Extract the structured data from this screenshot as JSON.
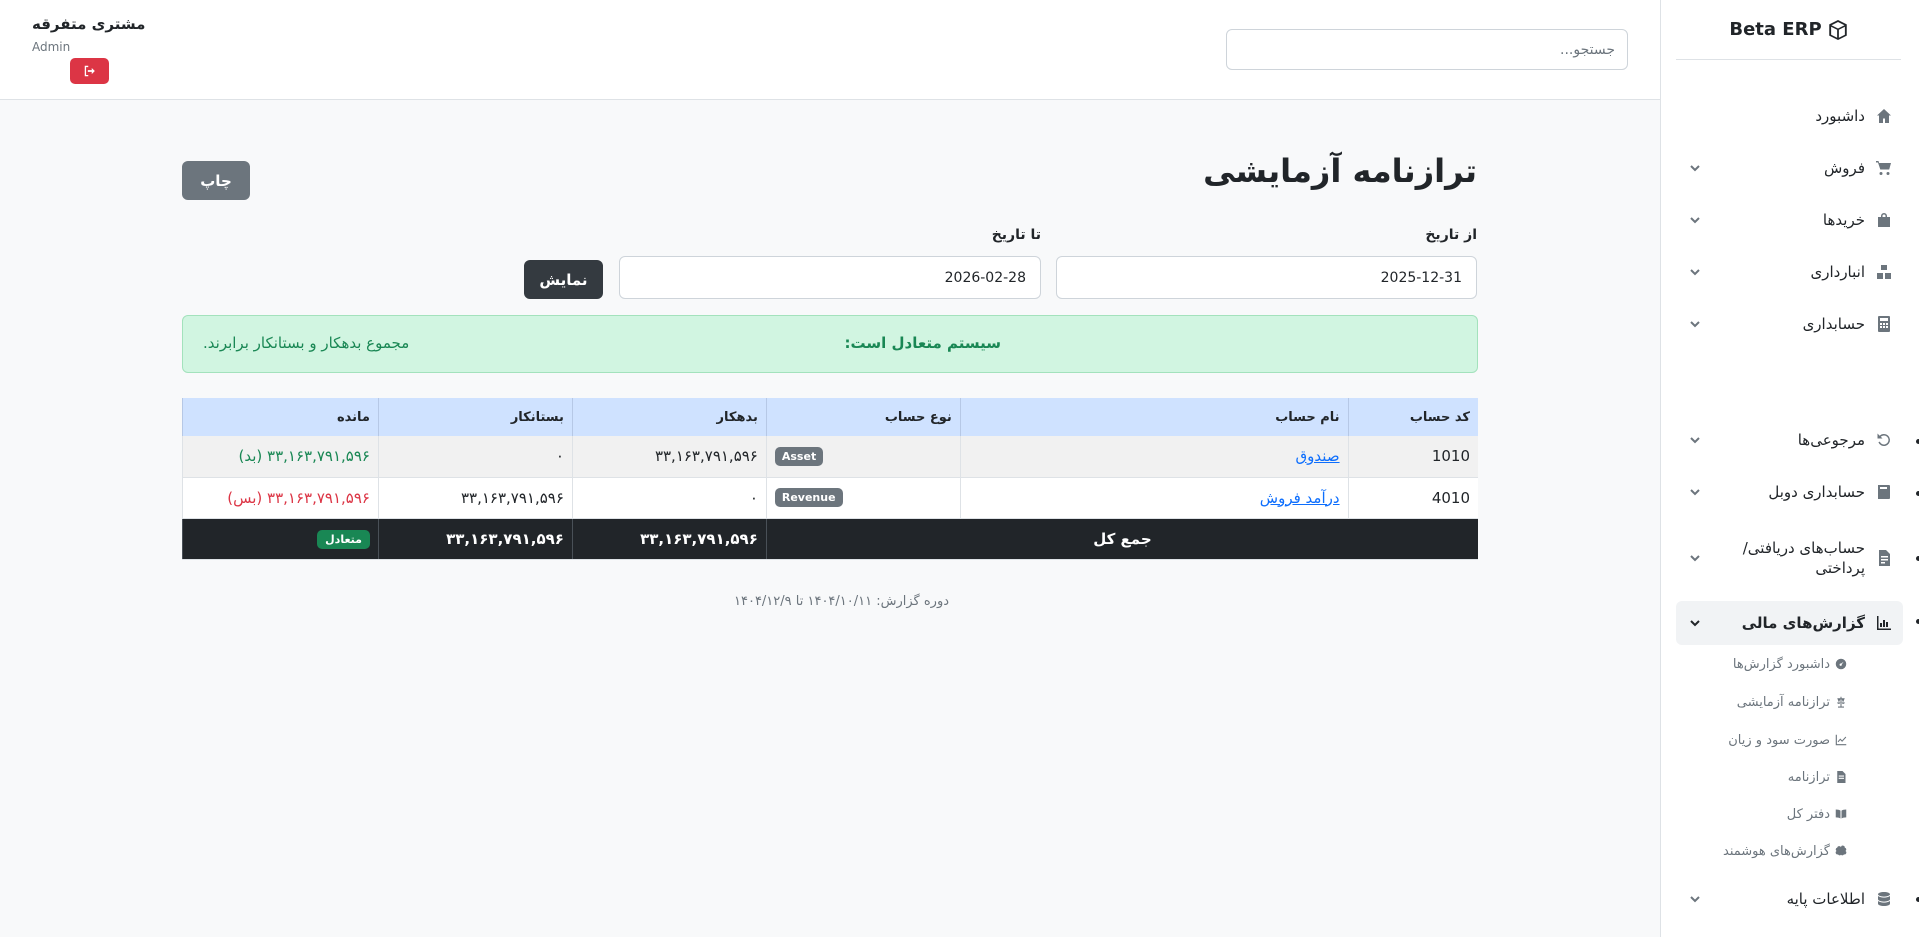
{
  "brand": {
    "name": "Beta ERP",
    "icon": "cube-icon"
  },
  "header": {
    "search_placeholder": "جستجو...",
    "user_name": "مشتری متفرقه",
    "user_role": "Admin"
  },
  "sidebar": {
    "items": [
      {
        "label": "داشبورد",
        "icon": "home-icon"
      },
      {
        "label": "فروش",
        "icon": "cart-icon"
      },
      {
        "label": "خریدها",
        "icon": "bag-icon"
      },
      {
        "label": "انبارداری",
        "icon": "boxes-icon"
      },
      {
        "label": "حسابداری",
        "icon": "calculator-icon"
      },
      {
        "label": "مرجوعی‌ها",
        "icon": "undo-icon"
      },
      {
        "label": "حسابداری دوبل",
        "icon": "book-icon"
      },
      {
        "label": "حساب‌های دریافتی/پرداختی",
        "icon": "invoice-icon"
      },
      {
        "label": "گزارش‌های مالی",
        "icon": "chart-icon"
      },
      {
        "label": "اطلاعات پایه",
        "icon": "database-icon"
      }
    ],
    "sub_items": [
      {
        "label": "داشبورد گزارش‌ها",
        "icon": "gauge-icon"
      },
      {
        "label": "ترازنامه آزمایشی",
        "icon": "scale-icon"
      },
      {
        "label": "صورت سود و زیان",
        "icon": "line-chart-icon"
      },
      {
        "label": "ترازنامه",
        "icon": "document-icon"
      },
      {
        "label": "دفتر کل",
        "icon": "open-book-icon"
      },
      {
        "label": "گزارش‌های هوشمند",
        "icon": "brain-icon"
      }
    ]
  },
  "page": {
    "title": "ترازنامه آزمایشی",
    "print_label": "چاپ",
    "from_label": "از تاریخ",
    "to_label": "تا تاریخ",
    "from_value": "2025-12-31",
    "to_value": "2026-02-28",
    "show_label": "نمایش"
  },
  "alert": {
    "title": "سیستم متعادل است:",
    "message": "مجموع بدهکار و بستانکار برابرند.",
    "color": "#198754"
  },
  "table": {
    "headers": [
      "کد حساب",
      "نام حساب",
      "نوع حساب",
      "بدهکار",
      "بستانکار",
      "مانده"
    ],
    "rows": [
      {
        "code": "1010",
        "name": "صندوق",
        "type": "Asset",
        "debit": "۳۳,۱۶۳,۷۹۱,۵۹۶",
        "credit": "۰",
        "balance": "۳۳,۱۶۳,۷۹۱,۵۹۶ (بد)"
      },
      {
        "code": "4010",
        "name": "درآمد فروش",
        "type": "Revenue",
        "debit": "۰",
        "credit": "۳۳,۱۶۳,۷۹۱,۵۹۶",
        "balance": "۳۳,۱۶۳,۷۹۱,۵۹۶ (بس)"
      }
    ],
    "total": {
      "label": "جمع کل",
      "debit": "۳۳,۱۶۳,۷۹۱,۵۹۶",
      "credit": "۳۳,۱۶۳,۷۹۱,۵۹۶",
      "status": "متعادل"
    }
  },
  "period": "دوره گزارش: ۱۴۰۴/۱۰/۱۱ تا ۱۴۰۴/۱۲/۹"
}
